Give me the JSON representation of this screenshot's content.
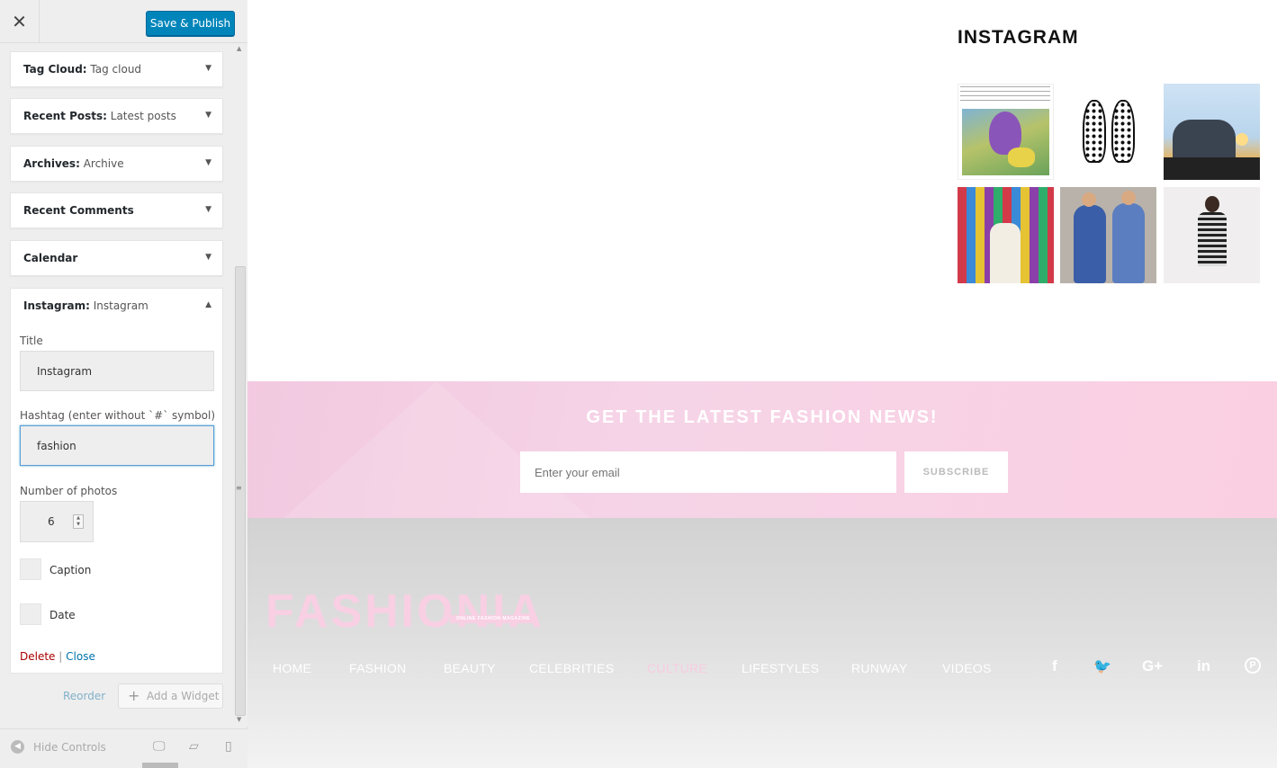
{
  "header": {
    "close_icon": "close-icon",
    "publish_label": "Save & Publish"
  },
  "widgets": [
    {
      "name": "Tag Cloud:",
      "sub": " Tag cloud"
    },
    {
      "name": "Recent Posts:",
      "sub": " Latest posts"
    },
    {
      "name": "Archives:",
      "sub": " Archive"
    },
    {
      "name": "Recent Comments",
      "sub": ""
    },
    {
      "name": "Calendar",
      "sub": ""
    }
  ],
  "instagram_widget": {
    "name": "Instagram:",
    "sub": " Instagram",
    "title_label": "Title",
    "title_value": "Instagram",
    "hashtag_label": "Hashtag (enter without `#` symbol)",
    "hashtag_value": "fashion",
    "photos_label": "Number of photos",
    "photos_value": "6",
    "caption_label": "Caption",
    "date_label": "Date",
    "delete_label": "Delete",
    "separator": "|",
    "close_label": "Close"
  },
  "panel_actions": {
    "reorder_label": "Reorder",
    "add_widget_label": "Add a Widget"
  },
  "footer_controls": {
    "hide_label": "Hide Controls",
    "devices": [
      "desktop-icon",
      "tablet-icon",
      "mobile-icon"
    ]
  },
  "preview": {
    "instagram_title": "INSTAGRAM",
    "thumbnails": [
      "comic-illustration-post",
      "black-polka-dot-shoes",
      "palace-sunset",
      "woman-colorful-wall",
      "two-women-blue-dresses",
      "woman-striped-dress"
    ],
    "newsletter": {
      "title": "GET THE LATEST FASHION NEWS!",
      "email_placeholder": "Enter your email",
      "subscribe_label": "SUBSCRIBE"
    },
    "logo": "FASHIONIA",
    "tagline": "ONLINE FASHION MAGAZINE",
    "nav": [
      "HOME",
      "FASHION",
      "BEAUTY",
      "CELEBRITIES",
      "CULTURE",
      "LIFESTYLES",
      "RUNWAY",
      "VIDEOS"
    ],
    "nav_active": "CULTURE",
    "social_icons": [
      "facebook-icon",
      "twitter-icon",
      "google-plus-icon",
      "linkedin-icon",
      "pinterest-icon"
    ]
  },
  "colors": {
    "accent": "#0085ba",
    "brand_pink": "#f8cfe3",
    "delete": "#aa0000"
  }
}
